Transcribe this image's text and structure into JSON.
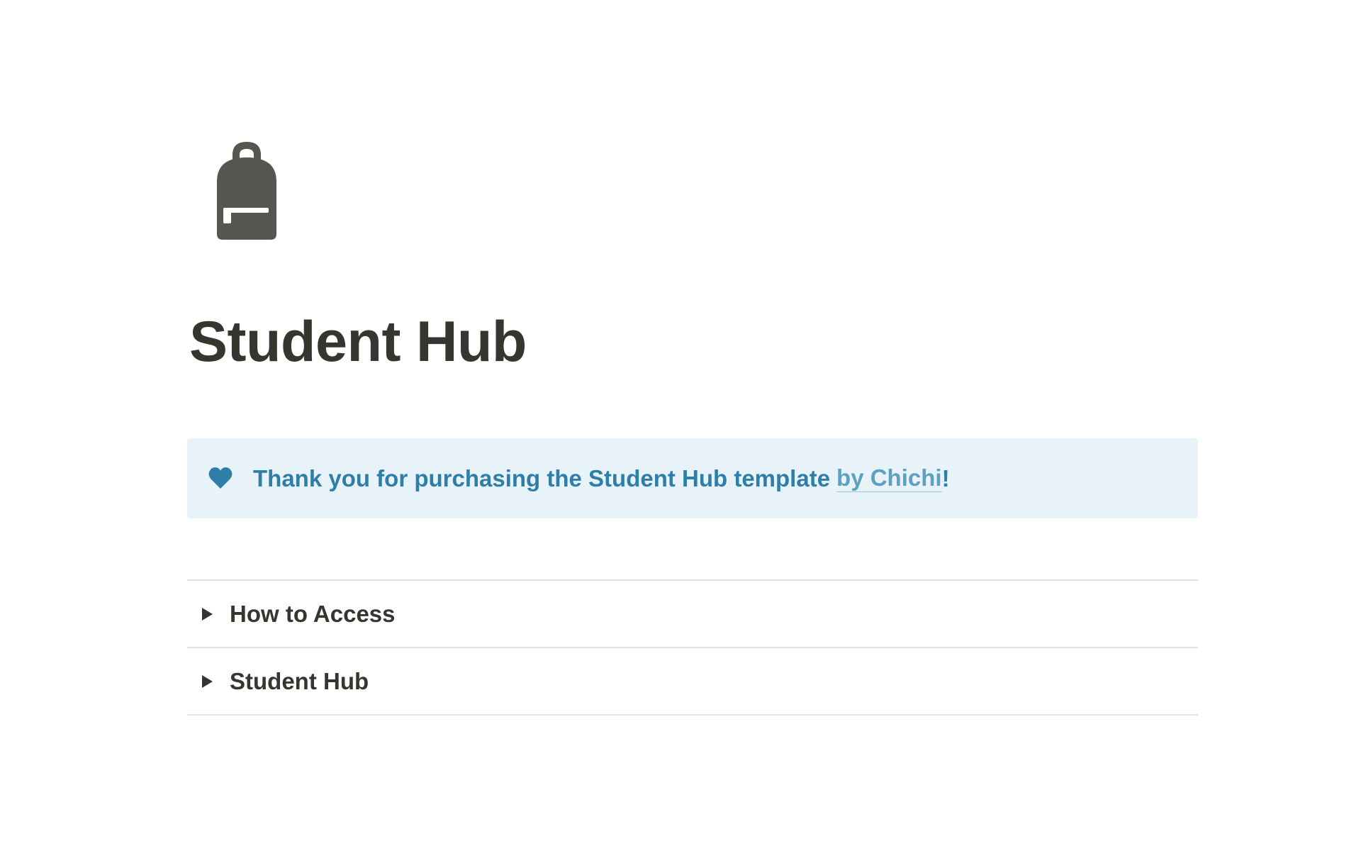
{
  "page": {
    "icon": "backpack-icon",
    "title": "Student Hub"
  },
  "callout": {
    "icon": "heart-icon",
    "text": "Thank you for purchasing the Student Hub template",
    "link_text": "by Chichi",
    "suffix": "!",
    "background_color": "#e7f3f8",
    "text_color": "#2e7ea8"
  },
  "toggles": [
    {
      "label": "How to Access"
    },
    {
      "label": "Student Hub"
    }
  ]
}
